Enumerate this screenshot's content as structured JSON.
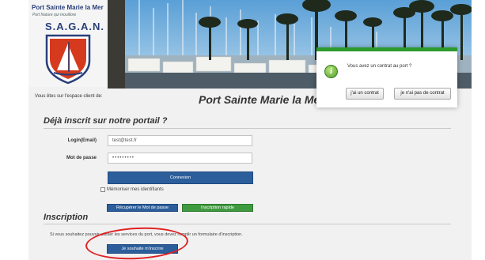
{
  "logo": {
    "top_name": "Port Sainte Marie la Mer",
    "motto": "Port Nature qui mouillore",
    "sagan": "S.A.G.A.N."
  },
  "header": {
    "space_text": "Vous êtes sur l'espace client de:",
    "port_title": "Port Sainte Marie la Me"
  },
  "login": {
    "section_title": "Déjà inscrit sur notre portail ?",
    "login_label": "Login(Email)",
    "login_value": "test@test.fr",
    "password_label": "Mot de passe",
    "password_value": "•••••••••",
    "connect_button": "Connexion",
    "remember_label": "Mémoriser mes identifiants",
    "recover_button": "Récupérer le Mot de passe",
    "quick_signup_button": "Inscription rapide"
  },
  "inscription": {
    "section_title": "Inscription",
    "text": "Si vous souhaitez pouvoir utiliser les services du port, vous devez remplir un formulaire d'inscription.",
    "signup_button": "Je souhaite m'inscrire"
  },
  "popup": {
    "question": "Vous avez un contrat au port ?",
    "yes_button": "j'ai un contrat",
    "no_button": "je n'ai pas de contrat",
    "accent_color": "#2c9a2c"
  },
  "colors": {
    "annotation": "#e02020",
    "primary_button": "#2b5e9a",
    "secondary_button": "#3f9a3f"
  }
}
